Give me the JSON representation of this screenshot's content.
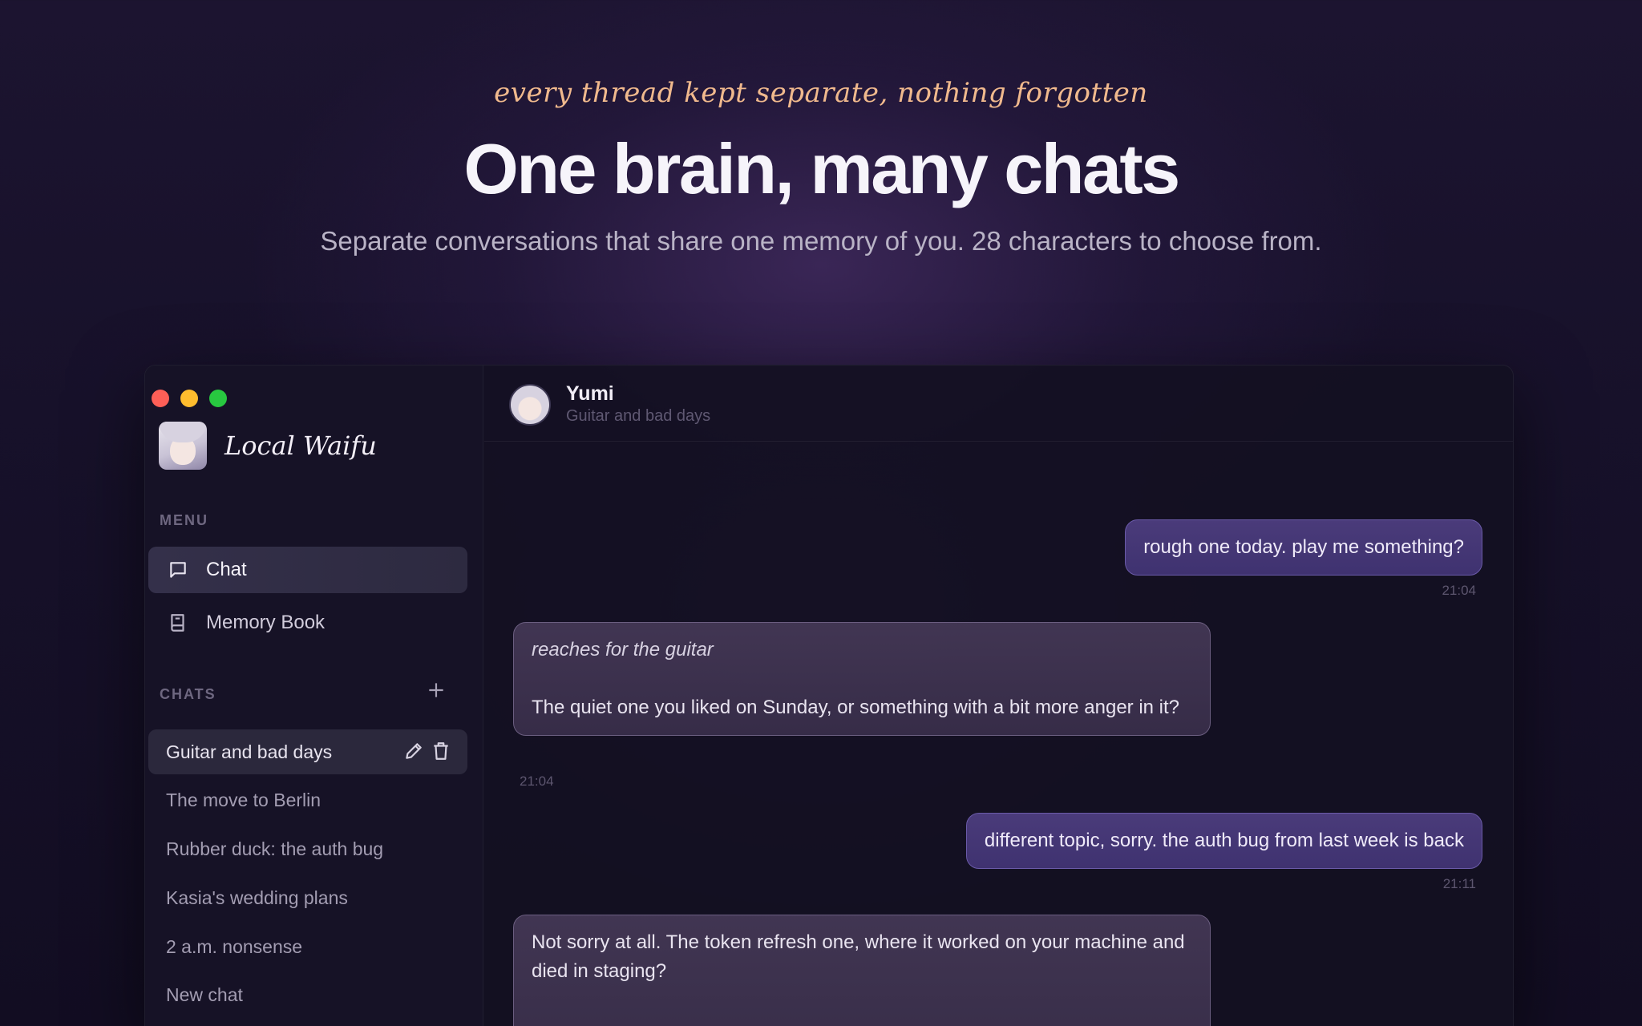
{
  "hero": {
    "tagline": "every thread kept separate, nothing forgotten",
    "headline": "One brain, many chats",
    "subline": "Separate conversations that share one memory of you. 28 characters to choose from."
  },
  "app": {
    "brand_name": "Local Waifu",
    "menu_label": "MENU",
    "nav": [
      {
        "label": "Chat",
        "icon": "chat-bubble-icon",
        "active": true
      },
      {
        "label": "Memory Book",
        "icon": "book-icon",
        "active": false
      }
    ],
    "chats_label": "CHATS",
    "chats": [
      {
        "label": "Guitar and bad days",
        "active": true
      },
      {
        "label": "The move to Berlin"
      },
      {
        "label": "Rubber duck: the auth bug"
      },
      {
        "label": "Kasia's wedding plans"
      },
      {
        "label": "2 a.m. nonsense"
      },
      {
        "label": "New chat"
      }
    ]
  },
  "conversation": {
    "character_name": "Yumi",
    "chat_title": "Guitar and bad days",
    "messages": [
      {
        "role": "user",
        "text": "rough one today. play me something?",
        "time": "21:04"
      },
      {
        "role": "assistant",
        "action": "reaches for the guitar",
        "text": "The quiet one you liked on Sunday, or something with a bit more anger in it?",
        "time": "21:04"
      },
      {
        "role": "user",
        "text": "different topic, sorry. the auth bug from last week is back",
        "time": "21:11"
      },
      {
        "role": "assistant",
        "text": "Not sorry at all. The token refresh one, where it worked on your machine and died in staging?"
      }
    ]
  },
  "colors": {
    "accent_user_bubble": "#4a3b7a",
    "tagline": "#f0b98d",
    "traffic_red": "#fe5f57",
    "traffic_yellow": "#febc2e",
    "traffic_green": "#28c840"
  }
}
